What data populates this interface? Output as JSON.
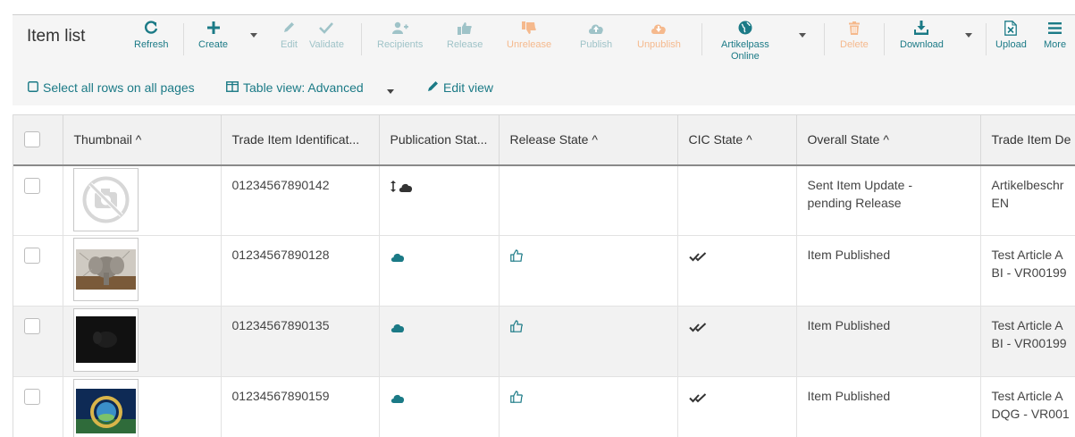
{
  "page": {
    "title": "Item list"
  },
  "toolbar": {
    "refresh": "Refresh",
    "create": "Create",
    "edit": "Edit",
    "validate": "Validate",
    "recipients": "Recipients",
    "release": "Release",
    "unrelease": "Unrelease",
    "publish": "Publish",
    "unpublish": "Unpublish",
    "artikelpass_line1": "Artikelpass",
    "artikelpass_line2": "Online",
    "delete": "Delete",
    "download": "Download",
    "upload": "Upload",
    "more": "More"
  },
  "subbar": {
    "select_all": "Select all rows on all pages",
    "table_view": "Table view: Advanced",
    "edit_view": "Edit view"
  },
  "table": {
    "columns": [
      "Thumbnail ^",
      "Trade Item Identificat...",
      "Publication Stat...",
      "Release State ^",
      "CIC State ^",
      "Overall State ^",
      "Trade Item De"
    ],
    "rows": [
      {
        "thumbnail": "no-image-icon",
        "gtin": "01234567890142",
        "publication": "upload-pending",
        "release": "",
        "cic": "",
        "overall_line1": "Sent Item Update -",
        "overall_line2": "pending Release",
        "desc_line1": "Artikelbeschr",
        "desc_line2": "EN"
      },
      {
        "thumbnail": "elephant-image",
        "gtin": "01234567890128",
        "publication": "published",
        "release": "thumbs-up",
        "cic": "double-check",
        "overall_line1": "Item Published",
        "overall_line2": "",
        "desc_line1": "Test Article A",
        "desc_line2": "BI - VR00199"
      },
      {
        "thumbnail": "dark-image",
        "gtin": "01234567890135",
        "publication": "published",
        "release": "thumbs-up",
        "cic": "double-check",
        "overall_line1": "Item Published",
        "overall_line2": "",
        "desc_line1": "Test Article A",
        "desc_line2": "BI - VR00199"
      },
      {
        "thumbnail": "globe-image",
        "gtin": "01234567890159",
        "publication": "published",
        "release": "thumbs-up",
        "cic": "double-check",
        "overall_line1": "Item Published",
        "overall_line2": "",
        "desc_line1": "Test Article A",
        "desc_line2": "DQG - VR001"
      }
    ]
  },
  "colors": {
    "teal": "#1b7a86",
    "teal_disabled": "#9fc3c8",
    "orange": "#e8782a",
    "orange_disabled": "#f5b98d",
    "header_bg": "#f5f5f5",
    "row_stripe": "#f2f2f2"
  }
}
